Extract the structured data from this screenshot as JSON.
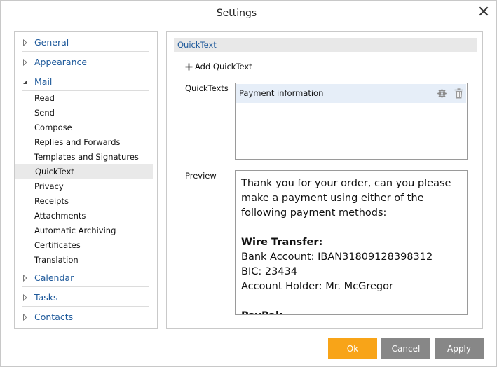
{
  "dialog": {
    "title": "Settings",
    "close_glyph": "✕"
  },
  "nav": {
    "categories": [
      {
        "label": "General",
        "state": "collapsed"
      },
      {
        "label": "Appearance",
        "state": "collapsed"
      },
      {
        "label": "Mail",
        "state": "expanded"
      },
      {
        "label": "Calendar",
        "state": "collapsed"
      },
      {
        "label": "Tasks",
        "state": "collapsed"
      },
      {
        "label": "Contacts",
        "state": "collapsed"
      }
    ],
    "mail_items": [
      "Read",
      "Send",
      "Compose",
      "Replies and Forwards",
      "Templates and Signatures",
      "QuickText",
      "Privacy",
      "Receipts",
      "Attachments",
      "Automatic Archiving",
      "Certificates",
      "Translation"
    ],
    "selected": "QuickText"
  },
  "content": {
    "section_title": "QuickText",
    "add_label": "Add QuickText",
    "quicktexts_label": "QuickTexts",
    "preview_label": "Preview",
    "quicktexts": [
      {
        "name": "Payment information"
      }
    ],
    "preview": {
      "intro": "Thank you for your order, can you please make a payment using either of the following payment methods:",
      "wire_heading": "Wire Transfer:",
      "bank_account": "Bank Account: IBAN31809128398312",
      "bic": "BIC: 23434",
      "account_holder": "Account Holder: Mr. McGregor",
      "next_heading": "PayPal:"
    }
  },
  "footer": {
    "ok_label": "Ok",
    "cancel_label": "Cancel",
    "apply_label": "Apply"
  },
  "colors": {
    "accent": "#f8a418",
    "link_blue": "#1f5a9b",
    "selection": "#e6eef8",
    "button_gray": "#878787"
  },
  "icons": {
    "add": "plus-icon",
    "settings": "gear-icon",
    "delete": "trash-icon",
    "close": "close-icon",
    "expand": "triangle-right-icon",
    "collapse": "triangle-down-icon"
  }
}
